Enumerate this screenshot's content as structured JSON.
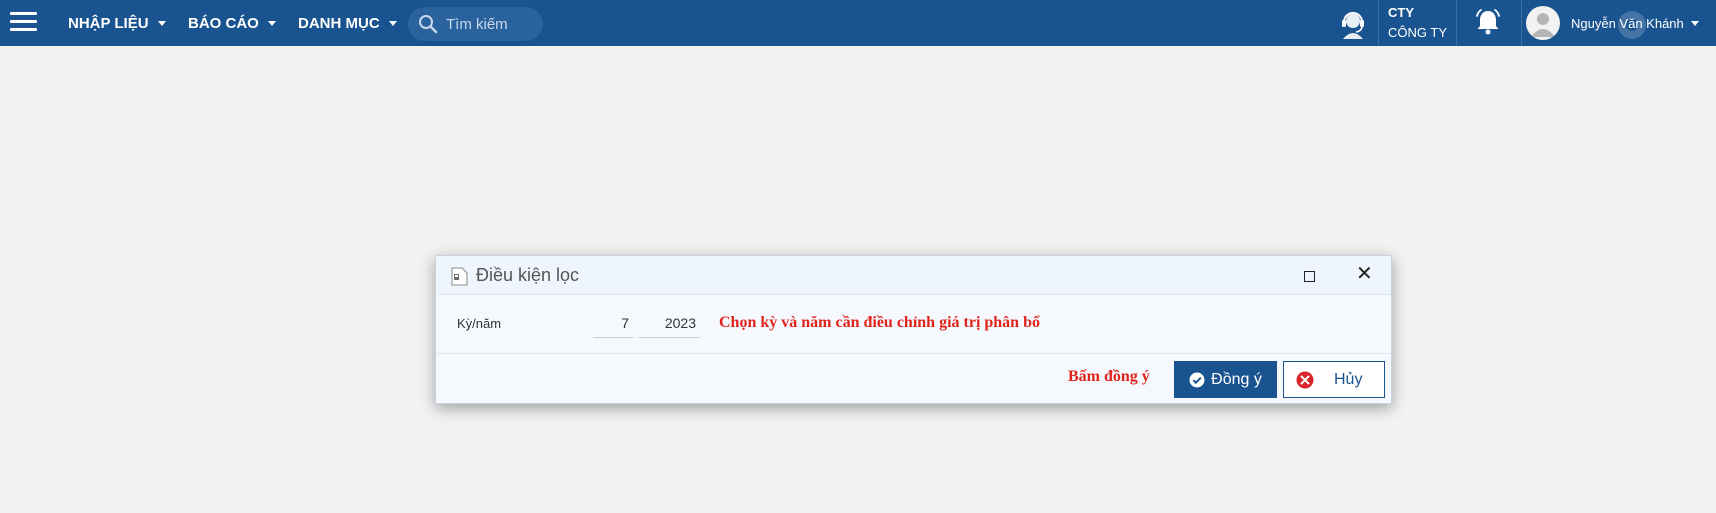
{
  "topbar": {
    "menu": [
      {
        "label": "NHẬP LIỆU"
      },
      {
        "label": "BÁO CÁO"
      },
      {
        "label": "DANH MỤC"
      }
    ],
    "search_placeholder": "Tìm kiếm",
    "company_code": "CTY",
    "company_name": "CÔNG TY",
    "user_name": "Nguyễn Văn Khánh",
    "colors": {
      "bar": "#1a5490"
    }
  },
  "dialog": {
    "title": "Điều kiện lọc",
    "period_label": "Kỳ/năm",
    "period_value": "7",
    "year_value": "2023",
    "hint": "Chọn kỳ và năm cần điều chỉnh giá trị phân bổ",
    "press_hint": "Bấm đồng ý",
    "ok_label": "Đồng ý",
    "cancel_label": "Hủy",
    "colors": {
      "hint": "#e0241b",
      "primary": "#1a5490"
    }
  }
}
